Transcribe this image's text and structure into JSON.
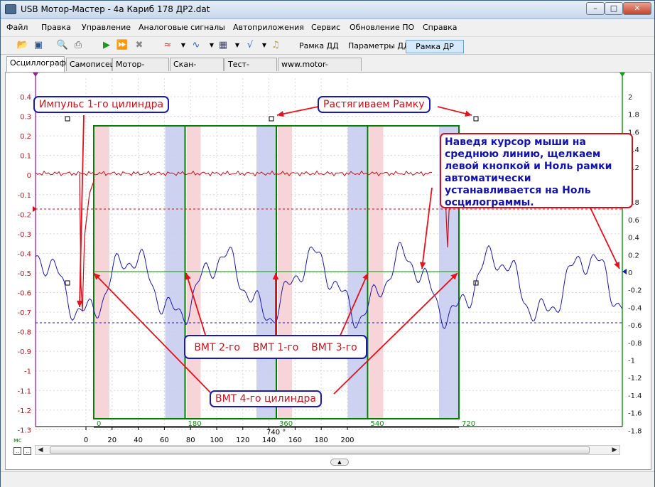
{
  "window": {
    "title": "USB Мотор-Мастер - 4а Кариб 178 ДР2.dat",
    "min_glyph": "–",
    "max_glyph": "□",
    "close_glyph": "✕"
  },
  "menu": [
    "Файл",
    "Правка",
    "Управление",
    "Аналоговые сигналы",
    "Автоприложения",
    "Сервис",
    "Обновление ПО",
    "Справка"
  ],
  "toolbar": {
    "frame_dd": "Рамка ДД",
    "params_dd": "Параметры ДД",
    "frame_dr": "Рамка ДР"
  },
  "tabs": [
    "Осциллограф",
    "Самописец",
    "Мотор-тестер",
    "Скан-Тестер",
    "Тест-мастер",
    "www.motor-master.ru"
  ],
  "axes": {
    "left_ticks": [
      "0.4",
      "0.3",
      "0.2",
      "0.1",
      "0",
      "-0.1",
      "-0.2",
      "-0.3",
      "-0.4",
      "-0.5",
      "-0.6",
      "-0.7",
      "-0.8",
      "-0.9",
      "-1",
      "-1.1",
      "-1.2",
      "-1.3"
    ],
    "right_ticks": [
      "2",
      "1.8",
      "1.6",
      "1.4",
      "1.2",
      "1",
      "0.8",
      "0.6",
      "0.4",
      "0.2",
      "0",
      "-0.2",
      "-0.4",
      "-0.6",
      "-0.8",
      "-1",
      "-1.2",
      "-1.4",
      "-1.6",
      "-1.8"
    ],
    "bottom_ticks": [
      "0",
      "20",
      "40",
      "60",
      "80",
      "100",
      "120",
      "140",
      "160",
      "180",
      "200"
    ],
    "frame_degrees": [
      "0",
      "180",
      "360",
      "540",
      "720"
    ],
    "frame_width_label": "740 °",
    "time_unit": "мс"
  },
  "callouts": {
    "impulse": "Импульс 1-го цилиндра",
    "stretch": "Растягиваем Рамку",
    "cursor_hint": "Наведя курсор мыши на среднюю линию, щелкаем левой кнопкой и Ноль рамки автоматически устанавливается на Ноль осцилограммы.",
    "bmt2": "ВМТ 2-го",
    "bmt1": "ВМТ 1-го",
    "bmt3": "ВМТ 3-го",
    "bmt4": "ВМТ 4-го цилиндра"
  },
  "colors": {
    "signal_blue": "#1a1ab4",
    "signal_red": "#c8101a",
    "frame_green": "#008000",
    "band_blue": "#c8cdf0",
    "band_pink": "#f6d2d6",
    "arrow_red": "#e8101a"
  }
}
